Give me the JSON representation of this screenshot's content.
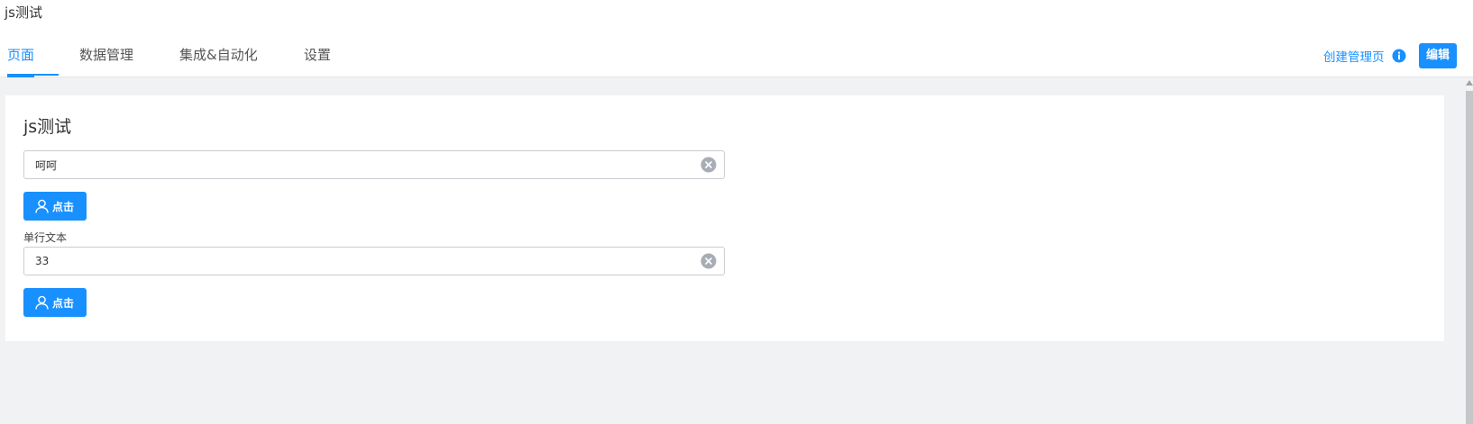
{
  "app": {
    "title": "js测试"
  },
  "tabs": [
    {
      "label": "页面",
      "active": true
    },
    {
      "label": "数据管理",
      "active": false
    },
    {
      "label": "集成&自动化",
      "active": false
    },
    {
      "label": "设置",
      "active": false
    }
  ],
  "header_actions": {
    "create_admin_page": "创建管理页",
    "info_icon": "info-icon",
    "edit_button": "编辑"
  },
  "page": {
    "title": "js测试",
    "field1": {
      "value": "呵呵",
      "clear_icon": "close-circle-icon"
    },
    "button1": {
      "label": "点击",
      "icon": "user-icon"
    },
    "field2": {
      "label": "单行文本",
      "value": "33",
      "clear_icon": "close-circle-icon"
    },
    "button2": {
      "label": "点击",
      "icon": "user-icon"
    }
  },
  "colors": {
    "accent": "#1890ff",
    "background": "#f1f2f4",
    "surface": "#ffffff"
  }
}
